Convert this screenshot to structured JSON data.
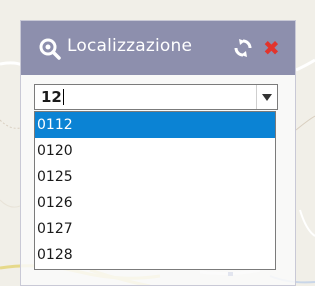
{
  "panel": {
    "title": "Localizzazione",
    "header_color": "#8d8fad",
    "close_glyph": "✖",
    "icons": [
      "search-location-icon",
      "refresh-icon",
      "close-icon"
    ]
  },
  "combo": {
    "value": "12"
  },
  "dropdown": {
    "highlight_color": "#0b83d4",
    "options": [
      "0112",
      "0120",
      "0125",
      "0126",
      "0127",
      "0128"
    ],
    "selected_index": 0
  }
}
